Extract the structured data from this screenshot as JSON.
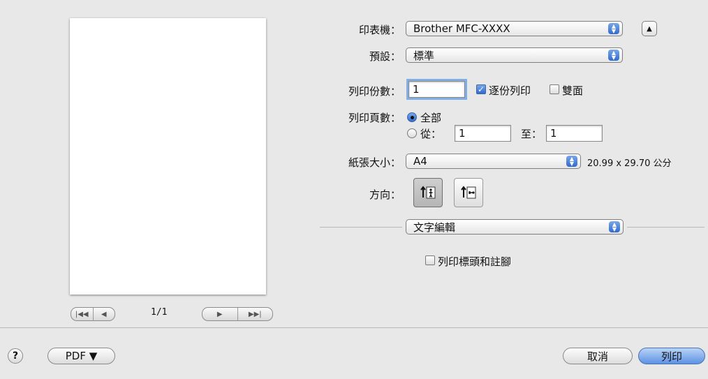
{
  "preview": {
    "page_indicator": "1/1"
  },
  "printer": {
    "label": "印表機：",
    "value": "Brother MFC-XXXX"
  },
  "presets": {
    "label": "預設：",
    "value": "標準"
  },
  "copies": {
    "label": "列印份數：",
    "value": "1",
    "collate_label": "逐份列印",
    "collate_checked": true,
    "duplex_label": "雙面",
    "duplex_checked": false
  },
  "pages": {
    "label": "列印頁數：",
    "all_label": "全部",
    "from_label": "從：",
    "from_value": "1",
    "to_label": "至：",
    "to_value": "1",
    "selected": "all"
  },
  "paper_size": {
    "label": "紙張大小：",
    "value": "A4",
    "dimensions": "20.99 x 29.70 公分"
  },
  "orientation": {
    "label": "方向：",
    "selected": "portrait"
  },
  "section_popup": {
    "value": "文字編輯"
  },
  "header_footer": {
    "label": "列印標頭和註腳",
    "checked": false
  },
  "footer": {
    "help": "?",
    "pdf_label": "PDF ▼",
    "cancel_label": "取消",
    "print_label": "列印"
  },
  "icons": {
    "help": "help-icon",
    "printer_toggle": "disclosure-triangle-icon",
    "portrait": "portrait-orientation-icon",
    "landscape": "landscape-orientation-icon"
  }
}
